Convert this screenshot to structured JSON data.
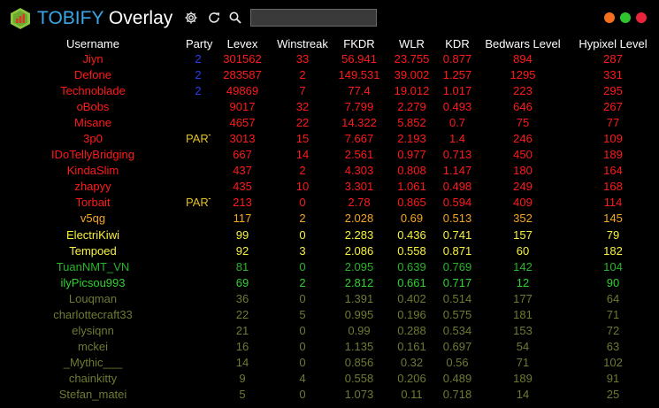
{
  "app": {
    "title_brand": "TOBIFY",
    "title_suffix": " Overlay",
    "icons": [
      "logo-icon",
      "gear-icon",
      "refresh-icon",
      "search-icon"
    ],
    "search_value": "",
    "window_controls": [
      {
        "name": "minimize",
        "color": "#f4701e"
      },
      {
        "name": "maximize",
        "color": "#2fc52f"
      },
      {
        "name": "close",
        "color": "#e8253b"
      }
    ]
  },
  "table": {
    "columns": [
      "Username",
      "Party",
      "Levex",
      "Winstreak",
      "FKDR",
      "WLR",
      "KDR",
      "Bedwars Level",
      "Hypixel Level"
    ],
    "rows": [
      {
        "username": "Jiyn",
        "party": "2",
        "levex": "301562",
        "winstreak": "33",
        "fkdr": "56.941",
        "wlr": "23.755",
        "kdr": "0.877",
        "bedwars": "894",
        "hypixel": "287",
        "color": "#ff1a1a"
      },
      {
        "username": "Defone",
        "party": "2",
        "levex": "283587",
        "winstreak": "2",
        "fkdr": "149.531",
        "wlr": "39.002",
        "kdr": "1.257",
        "bedwars": "1295",
        "hypixel": "331",
        "color": "#ff1a1a"
      },
      {
        "username": "Technoblade",
        "party": "2",
        "levex": "49869",
        "winstreak": "7",
        "fkdr": "77.4",
        "wlr": "19.012",
        "kdr": "1.017",
        "bedwars": "223",
        "hypixel": "295",
        "color": "#ff1a1a"
      },
      {
        "username": "oBobs",
        "party": "",
        "levex": "9017",
        "winstreak": "32",
        "fkdr": "7.799",
        "wlr": "2.279",
        "kdr": "0.493",
        "bedwars": "646",
        "hypixel": "267",
        "color": "#ff1a1a"
      },
      {
        "username": "Misane",
        "party": "",
        "levex": "4657",
        "winstreak": "22",
        "fkdr": "14.322",
        "wlr": "5.852",
        "kdr": "0.7",
        "bedwars": "75",
        "hypixel": "77",
        "color": "#ff1a1a"
      },
      {
        "username": "3p0",
        "party": "PARTY",
        "levex": "3013",
        "winstreak": "15",
        "fkdr": "7.667",
        "wlr": "2.193",
        "kdr": "1.4",
        "bedwars": "246",
        "hypixel": "109",
        "color": "#ff1a1a"
      },
      {
        "username": "IDoTellyBridging",
        "party": "",
        "levex": "667",
        "winstreak": "14",
        "fkdr": "2.561",
        "wlr": "0.977",
        "kdr": "0.713",
        "bedwars": "450",
        "hypixel": "189",
        "color": "#ff1a1a"
      },
      {
        "username": "KindaSlim",
        "party": "",
        "levex": "437",
        "winstreak": "2",
        "fkdr": "4.303",
        "wlr": "0.808",
        "kdr": "1.147",
        "bedwars": "180",
        "hypixel": "164",
        "color": "#ff1a1a"
      },
      {
        "username": "zhapyy",
        "party": "",
        "levex": "435",
        "winstreak": "10",
        "fkdr": "3.301",
        "wlr": "1.061",
        "kdr": "0.498",
        "bedwars": "249",
        "hypixel": "168",
        "color": "#ff1a1a"
      },
      {
        "username": "Torbait",
        "party": "PARTY",
        "levex": "213",
        "winstreak": "0",
        "fkdr": "2.78",
        "wlr": "0.865",
        "kdr": "0.594",
        "bedwars": "409",
        "hypixel": "114",
        "color": "#ff1a1a"
      },
      {
        "username": "v5qg",
        "party": "",
        "levex": "117",
        "winstreak": "2",
        "fkdr": "2.028",
        "wlr": "0.69",
        "kdr": "0.513",
        "bedwars": "352",
        "hypixel": "145",
        "color": "#f5a623"
      },
      {
        "username": "ElectriKiwi",
        "party": "",
        "levex": "99",
        "winstreak": "0",
        "fkdr": "2.283",
        "wlr": "0.436",
        "kdr": "0.741",
        "bedwars": "157",
        "hypixel": "79",
        "color": "#f8f23a"
      },
      {
        "username": "Tempoed",
        "party": "",
        "levex": "92",
        "winstreak": "3",
        "fkdr": "2.086",
        "wlr": "0.558",
        "kdr": "0.871",
        "bedwars": "60",
        "hypixel": "182",
        "color": "#f8f23a"
      },
      {
        "username": "TuanNMT_VN",
        "party": "",
        "levex": "81",
        "winstreak": "0",
        "fkdr": "2.095",
        "wlr": "0.639",
        "kdr": "0.769",
        "bedwars": "142",
        "hypixel": "104",
        "color": "#28b428"
      },
      {
        "username": "ilyPicsou993",
        "party": "",
        "levex": "69",
        "winstreak": "2",
        "fkdr": "2.812",
        "wlr": "0.661",
        "kdr": "0.717",
        "bedwars": "12",
        "hypixel": "90",
        "color": "#2fd22f"
      },
      {
        "username": "Louqman",
        "party": "",
        "levex": "36",
        "winstreak": "0",
        "fkdr": "1.391",
        "wlr": "0.402",
        "kdr": "0.514",
        "bedwars": "177",
        "hypixel": "64",
        "color": "#6f7a31"
      },
      {
        "username": "charlottecraft33",
        "party": "",
        "levex": "22",
        "winstreak": "5",
        "fkdr": "0.995",
        "wlr": "0.196",
        "kdr": "0.575",
        "bedwars": "181",
        "hypixel": "71",
        "color": "#6f7a31"
      },
      {
        "username": "elysiqnn",
        "party": "",
        "levex": "21",
        "winstreak": "0",
        "fkdr": "0.99",
        "wlr": "0.288",
        "kdr": "0.534",
        "bedwars": "153",
        "hypixel": "72",
        "color": "#6f7a31"
      },
      {
        "username": "mckei",
        "party": "",
        "levex": "16",
        "winstreak": "0",
        "fkdr": "1.135",
        "wlr": "0.161",
        "kdr": "0.697",
        "bedwars": "54",
        "hypixel": "63",
        "color": "#6f7a31"
      },
      {
        "username": "_Mythic___",
        "party": "",
        "levex": "14",
        "winstreak": "0",
        "fkdr": "0.856",
        "wlr": "0.32",
        "kdr": "0.56",
        "bedwars": "71",
        "hypixel": "102",
        "color": "#6f7a31"
      },
      {
        "username": "chainkitty",
        "party": "",
        "levex": "9",
        "winstreak": "4",
        "fkdr": "0.558",
        "wlr": "0.206",
        "kdr": "0.489",
        "bedwars": "189",
        "hypixel": "91",
        "color": "#6f7a31"
      },
      {
        "username": "Stefan_matei",
        "party": "",
        "levex": "5",
        "winstreak": "0",
        "fkdr": "1.073",
        "wlr": "0.11",
        "kdr": "0.718",
        "bedwars": "14",
        "hypixel": "25",
        "color": "#6f7a31"
      }
    ],
    "party_colors": {
      "number": "#2b3cf0",
      "tag": "#e0c020"
    }
  }
}
